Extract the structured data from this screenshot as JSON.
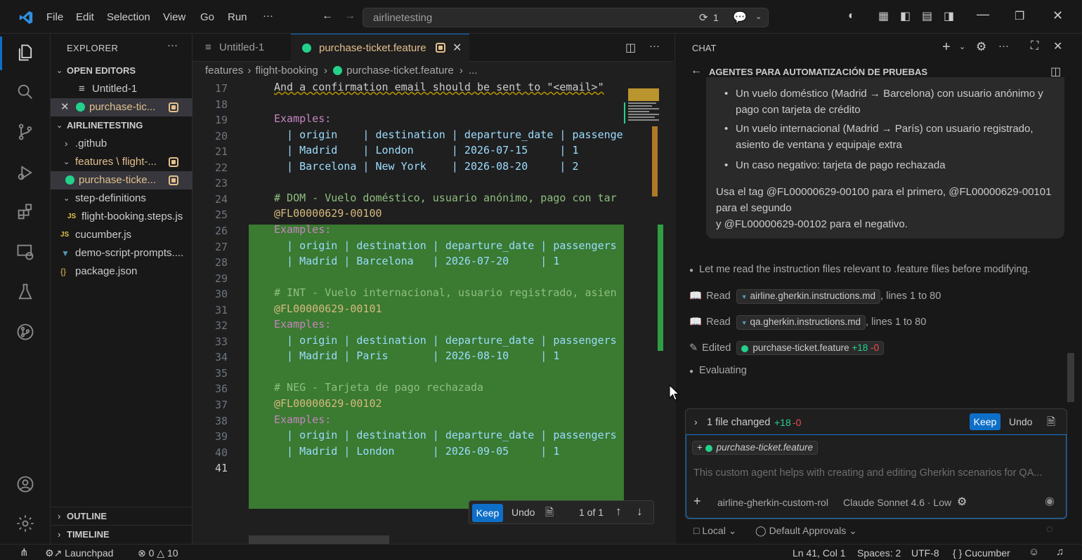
{
  "titlebar": {
    "menu": [
      "File",
      "Edit",
      "Selection",
      "View",
      "Go",
      "Run",
      "···"
    ],
    "search": "airlinetesting",
    "badge": "1"
  },
  "explorer": {
    "title": "EXPLORER",
    "open_editors_label": "OPEN EDITORS",
    "open_editors": [
      {
        "name": "Untitled-1"
      },
      {
        "name": "purchase-tic..."
      }
    ],
    "workspace_label": "AIRLINETESTING",
    "files": [
      {
        "name": ".github"
      },
      {
        "name": "features \\ flight-..."
      },
      {
        "name": "purchase-ticke..."
      },
      {
        "name": "step-definitions"
      },
      {
        "name": "flight-booking.steps.js"
      },
      {
        "name": "cucumber.js"
      },
      {
        "name": "demo-script-prompts...."
      },
      {
        "name": "package.json"
      }
    ],
    "outline_label": "OUTLINE",
    "timeline_label": "TIMELINE"
  },
  "editor": {
    "tabs": [
      {
        "label": "Untitled-1"
      },
      {
        "label": "purchase-ticket.feature"
      }
    ],
    "breadcrumb": [
      "features",
      "flight-booking",
      "purchase-ticket.feature",
      "..."
    ],
    "line_numbers": [
      "17",
      "18",
      "19",
      "20",
      "21",
      "22",
      "23",
      "24",
      "25",
      "26",
      "27",
      "28",
      "29",
      "30",
      "31",
      "32",
      "33",
      "34",
      "35",
      "36",
      "37",
      "38",
      "39",
      "40",
      "41"
    ],
    "lines": [
      {
        "t": "And a confirmation email should be sent to \"<email>\"",
        "k": "step"
      },
      {
        "t": "",
        "k": "plain"
      },
      {
        "t": "Examples:",
        "k": "kw"
      },
      {
        "t": "  | origin    | destination | departure_date | passenge",
        "k": "tbl"
      },
      {
        "t": "  | Madrid    | London      | 2026-07-15     | 1",
        "k": "tbl"
      },
      {
        "t": "  | Barcelona | New York    | 2026-08-20     | 2",
        "k": "tbl"
      },
      {
        "t": "",
        "k": "add"
      },
      {
        "t": "# DOM - Vuelo doméstico, usuario anónimo, pago con tar",
        "k": "addc"
      },
      {
        "t": "@FL00000629-00100",
        "k": "addt"
      },
      {
        "t": "Examples:",
        "k": "addk"
      },
      {
        "t": "  | origin | destination | departure_date | passengers",
        "k": "addb"
      },
      {
        "t": "  | Madrid | Barcelona   | 2026-07-20     | 1",
        "k": "addb"
      },
      {
        "t": "",
        "k": "add"
      },
      {
        "t": "# INT - Vuelo internacional, usuario registrado, asien",
        "k": "addc"
      },
      {
        "t": "@FL00000629-00101",
        "k": "addt"
      },
      {
        "t": "Examples:",
        "k": "addk"
      },
      {
        "t": "  | origin | destination | departure_date | passengers",
        "k": "addb"
      },
      {
        "t": "  | Madrid | Paris       | 2026-08-10     | 1",
        "k": "addb"
      },
      {
        "t": "",
        "k": "add"
      },
      {
        "t": "# NEG - Tarjeta de pago rechazada",
        "k": "addc"
      },
      {
        "t": "@FL00000629-00102",
        "k": "addt"
      },
      {
        "t": "Examples:",
        "k": "addk"
      },
      {
        "t": "  | origin | destination | departure_date | passengers",
        "k": "addb"
      },
      {
        "t": "  | Madrid | London      | 2026-09-05     | 1",
        "k": "addb"
      },
      {
        "t": "",
        "k": "plain"
      }
    ],
    "diff_bar": {
      "keep": "Keep",
      "undo": "Undo",
      "counter": "1 of 1"
    }
  },
  "chat": {
    "title": "CHAT",
    "session_title": "AGENTES PARA AUTOMATIZACIÓN DE PRUEBAS",
    "user_bullets": [
      "Un vuelo doméstico (Madrid → Barcelona) con usuario anónimo y",
      "pago con tarjeta de crédito",
      "Un vuelo internacional (Madrid → París) con usuario registrado,",
      "asiento de ventana y equipaje extra",
      "Un caso negativo: tarjeta de pago rechazada"
    ],
    "user_tail": [
      "Usa el tag @FL00000629-00100 para el primero, @FL00000629-00101",
      "para el segundo",
      "y @FL00000629-00102 para el negativo."
    ],
    "agent_note": "Let me read the instruction files relevant to .feature files before modifying.",
    "steps": [
      {
        "verb": "Read",
        "file": "airline.gherkin.instructions.md",
        "suffix": ", lines 1 to 80"
      },
      {
        "verb": "Read",
        "file": "qa.gherkin.instructions.md",
        "suffix": ", lines 1 to 80"
      },
      {
        "verb": "Edited",
        "file": "purchase-ticket.feature",
        "plus": "+18",
        "minus": "-0"
      }
    ],
    "evaluating": "Evaluating",
    "changes": {
      "label": "1 file changed",
      "plus": "+18",
      "minus": "-0",
      "keep": "Keep",
      "undo": "Undo"
    },
    "attachment": "purchase-ticket.feature",
    "placeholder": "This custom agent helps with creating and editing Gherkin scenarios for QA...",
    "agent": "airline-gherkin-custom-rol",
    "model": "Claude Sonnet 4.6 · Low",
    "location": "Local",
    "approvals": "Default Approvals"
  },
  "statusbar": {
    "launchpad": "Launchpad",
    "errors": "0",
    "warnings": "10",
    "position": "Ln 41, Col 1",
    "spaces": "Spaces: 2",
    "encoding": "UTF-8",
    "language": "Cucumber"
  },
  "colors": {
    "accent": "#0e6fc8",
    "added": "#3a7a31",
    "modified": "#e2c08d",
    "feature": "#23d18b"
  }
}
